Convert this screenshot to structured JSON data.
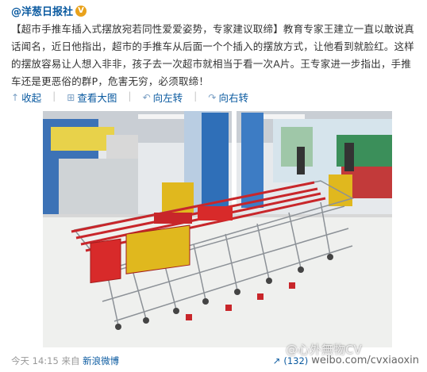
{
  "header": {
    "author": "@洋葱日报社",
    "verified_icon": "verified-badge-icon"
  },
  "post": {
    "text": "【超市手推车插入式摆放宛若同性爱爱姿势，专家建议取缔】教育专家王建立一直以敢说真话闻名，近日他指出，超市的手推车从后面一个个插入的摆放方式，让他看到就脸红。这样的摆放容易让人想入非非，孩子去一次超市就相当于看一次A片。王专家进一步指出，手推车还是更恶俗的群P，危害无穷，必须取缔！"
  },
  "actions": {
    "collapse": "收起",
    "view_large": "查看大图",
    "rotate_left": "向左转",
    "rotate_right": "向右转"
  },
  "footer": {
    "time": "今天 14:15",
    "source_label": "来自",
    "source": "新浪微博",
    "forward_count": "(132)",
    "watermark_url": "weibo.com/cvxiaoxin",
    "watermark_name": "@心外無物CV"
  },
  "colors": {
    "link": "#0a5aa0",
    "cart_red": "#c8262a"
  }
}
